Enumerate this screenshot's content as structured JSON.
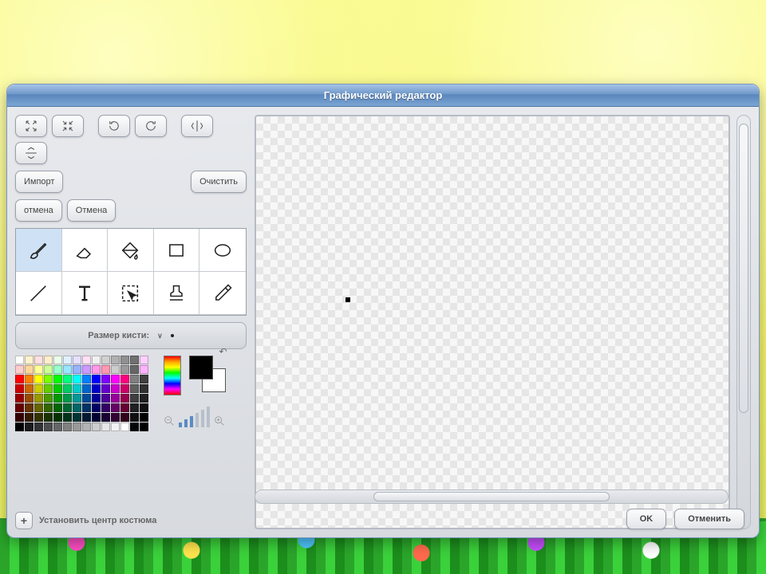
{
  "window": {
    "title": "Графический редактор"
  },
  "toolbar": {
    "grow": "grow-icon",
    "shrink": "shrink-icon",
    "rotate_ccw": "rotate-ccw-icon",
    "rotate_cw": "rotate-cw-icon",
    "flip_h": "flip-horizontal-icon",
    "flip_v": "flip-vertical-icon",
    "import_label": "Импорт",
    "clear_label": "Очистить",
    "undo_label": "отмена",
    "redo_label": "Отмена"
  },
  "tools": [
    {
      "name": "brush",
      "selected": true
    },
    {
      "name": "eraser",
      "selected": false
    },
    {
      "name": "fill",
      "selected": false
    },
    {
      "name": "rectangle",
      "selected": false
    },
    {
      "name": "ellipse",
      "selected": false
    },
    {
      "name": "line",
      "selected": false
    },
    {
      "name": "text",
      "selected": false
    },
    {
      "name": "select",
      "selected": false
    },
    {
      "name": "stamp",
      "selected": false
    },
    {
      "name": "eyedropper",
      "selected": false
    }
  ],
  "brush": {
    "label": "Размер кисти:"
  },
  "colors": {
    "foreground": "#000000",
    "background": "#ffffff",
    "palette": [
      "#ffffff",
      "#fff2cc",
      "#ffe0e0",
      "#ffeecc",
      "#eaffea",
      "#e0f0ff",
      "#e6e0ff",
      "#ffe0f4",
      "#f0f0f0",
      "#d0d0d0",
      "#b0b0b0",
      "#909090",
      "#707070",
      "#ffd0ff",
      "#ffcccc",
      "#ffd699",
      "#ffff99",
      "#ccff99",
      "#99ffcc",
      "#99e6ff",
      "#99b3ff",
      "#cc99ff",
      "#ff99e6",
      "#ff99b3",
      "#cccccc",
      "#999999",
      "#666666",
      "#ffb3ff",
      "#ff0000",
      "#ff8000",
      "#ffff00",
      "#80ff00",
      "#00ff00",
      "#00ff80",
      "#00ffff",
      "#0080ff",
      "#0000ff",
      "#8000ff",
      "#ff00ff",
      "#ff0080",
      "#808080",
      "#404040",
      "#cc0000",
      "#cc6600",
      "#cccc00",
      "#66cc00",
      "#00cc00",
      "#00cc66",
      "#00cccc",
      "#0066cc",
      "#0000cc",
      "#6600cc",
      "#cc00cc",
      "#cc0066",
      "#606060",
      "#303030",
      "#990000",
      "#994c00",
      "#999900",
      "#4c9900",
      "#009900",
      "#00994c",
      "#009999",
      "#004c99",
      "#000099",
      "#4c0099",
      "#990099",
      "#99004c",
      "#404040",
      "#202020",
      "#660000",
      "#663300",
      "#666600",
      "#336600",
      "#006600",
      "#006633",
      "#006666",
      "#003366",
      "#000066",
      "#330066",
      "#660066",
      "#660033",
      "#202020",
      "#101010",
      "#330000",
      "#331a00",
      "#333300",
      "#1a3300",
      "#003300",
      "#00331a",
      "#003333",
      "#001a33",
      "#000033",
      "#1a0033",
      "#330033",
      "#33001a",
      "#101010",
      "#000000",
      "#000000",
      "#1a1a1a",
      "#333333",
      "#4d4d4d",
      "#666666",
      "#808080",
      "#999999",
      "#b3b3b3",
      "#cccccc",
      "#e6e6e6",
      "#f2f2f2",
      "#ffffff",
      "#050505",
      "#000000"
    ]
  },
  "zoom": {
    "level": 2,
    "bars": [
      6,
      10,
      14,
      18,
      22,
      26
    ]
  },
  "center": {
    "label": "Установить центр костюма"
  },
  "footer": {
    "ok": "OK",
    "cancel": "Отменить"
  }
}
